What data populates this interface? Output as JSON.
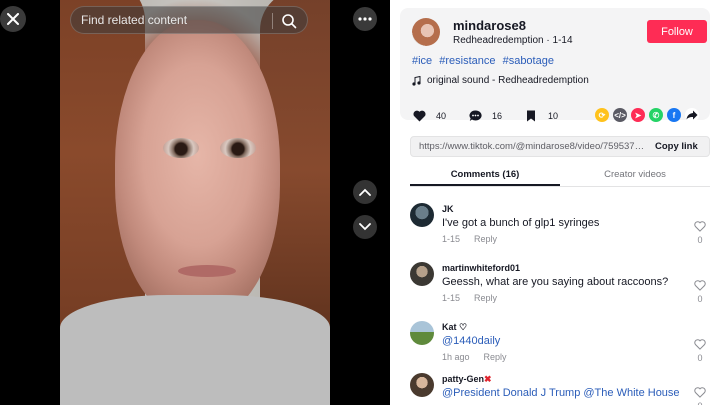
{
  "search": {
    "placeholder": "Find related content"
  },
  "post": {
    "username": "mindarose8",
    "nickname": "Redheadredemption",
    "date": "1-14",
    "follow_label": "Follow",
    "hashtags": [
      "#ice",
      "#resistance",
      "#sabotage"
    ],
    "sound": "original sound - Redheadredemption",
    "likes": "40",
    "comments_count": "16",
    "saves": "10",
    "link": "https://www.tiktok.com/@mindarose8/video/75953789...",
    "copy_label": "Copy link"
  },
  "tabs": [
    {
      "label": "Comments (16)"
    },
    {
      "label": "Creator videos"
    }
  ],
  "comments": [
    {
      "user": "JK",
      "text": "I've got a bunch of glp1 syringes",
      "date": "1-15",
      "reply": "Reply",
      "likes": "0"
    },
    {
      "user": "martinwhiteford01",
      "text": "Geessh, what are you saying about raccoons?",
      "date": "1-15",
      "reply": "Reply",
      "likes": "0"
    },
    {
      "user": "Kat",
      "user_badge": "♡",
      "text": "@1440daily",
      "date": "1h ago",
      "reply": "Reply",
      "likes": "0"
    },
    {
      "user": "patty-Gen",
      "user_badge": "✖",
      "text": "@President Donald J Trump @The White House",
      "likes": "0"
    }
  ],
  "colors": {
    "follow": "#fe2c55",
    "hashtag": "#2b5db9",
    "link_box": "#f1f1f2"
  },
  "icons": [
    "close-icon",
    "search-icon",
    "more-icon",
    "chevron-up-icon",
    "chevron-down-icon",
    "music-note-icon",
    "heart-icon",
    "comment-icon",
    "bookmark-icon",
    "share-arrow-icon"
  ]
}
